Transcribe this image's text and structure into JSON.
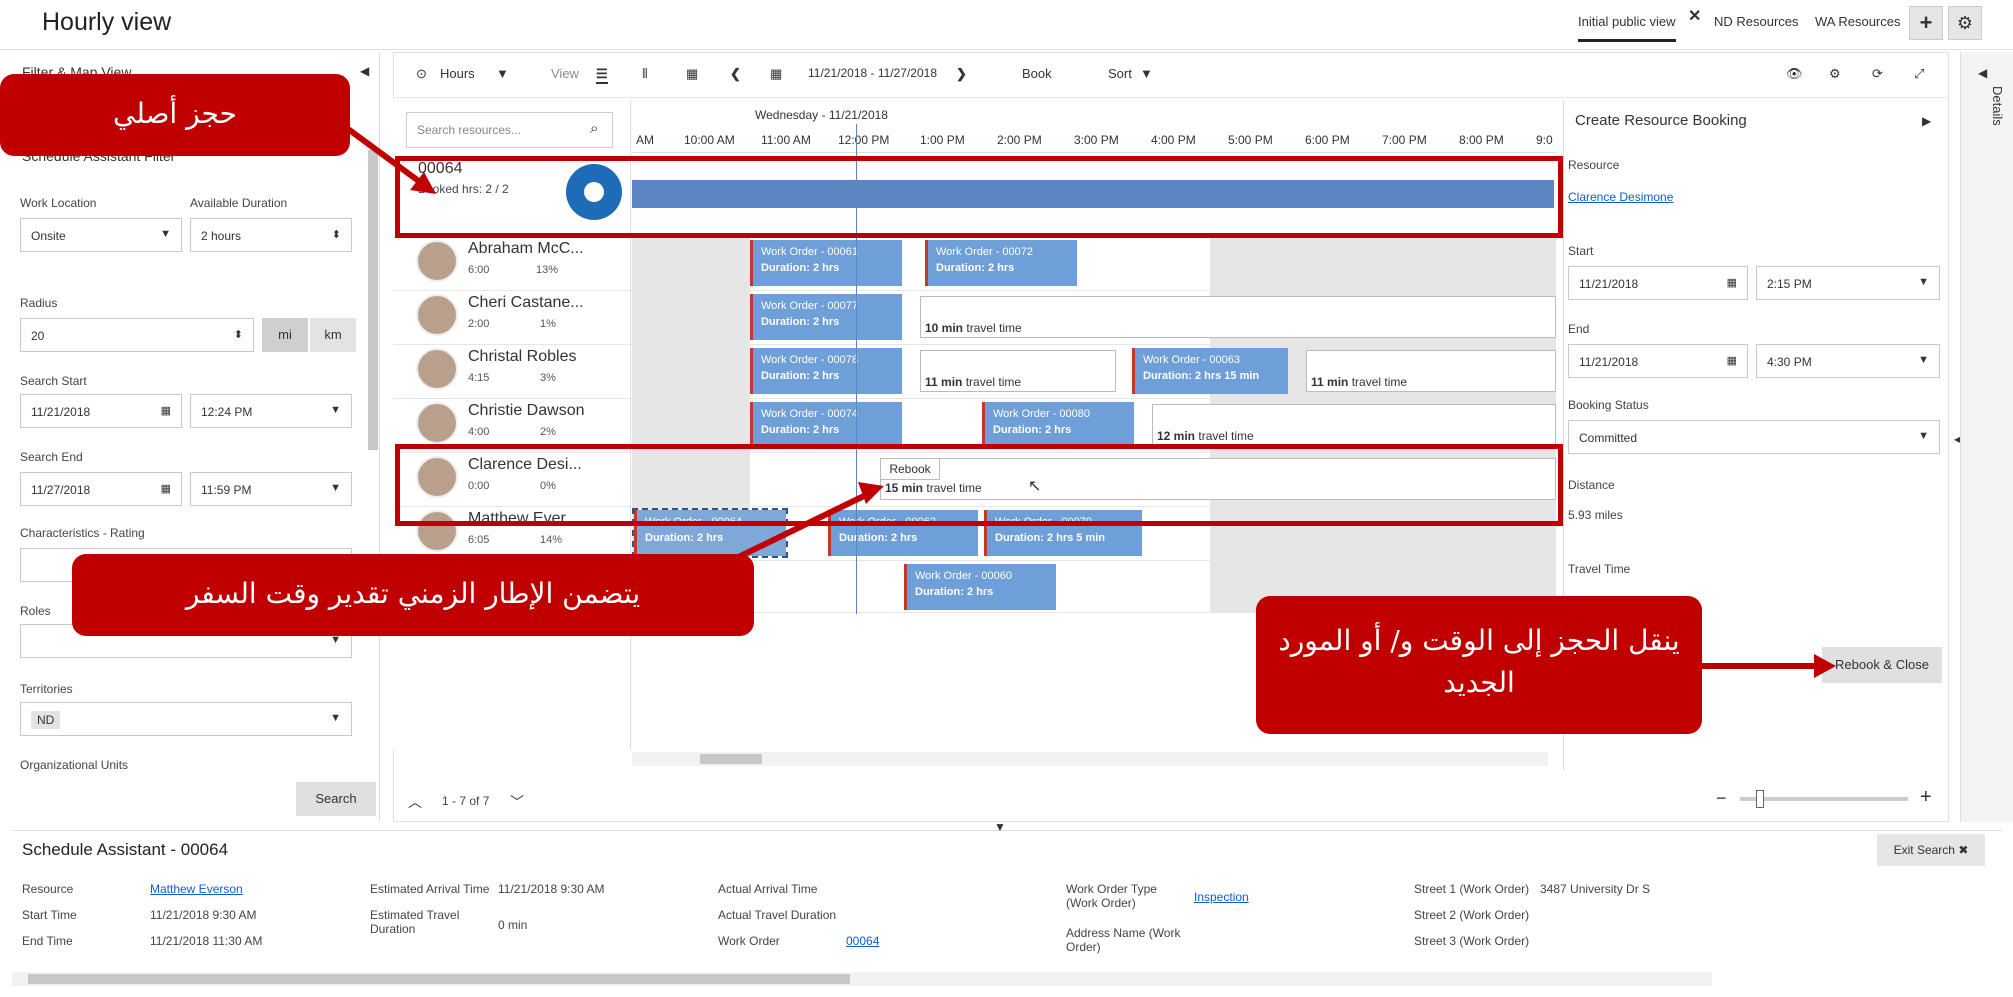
{
  "app": {
    "title": "Hourly view"
  },
  "top_tabs": [
    {
      "label": "Initial public view",
      "close": "✕"
    },
    {
      "label": "ND Resources"
    },
    {
      "label": "WA Resources"
    }
  ],
  "top_actions": {
    "add": "+",
    "settings": "⚙"
  },
  "left_panel": {
    "header": "Filter & Map View",
    "subheader": "Schedule Assistant Filter",
    "work_location": {
      "label": "Work Location",
      "value": "Onsite"
    },
    "available_duration": {
      "label": "Available Duration",
      "value": "2 hours"
    },
    "radius": {
      "label": "Radius",
      "value": "20",
      "unit_mi": "mi",
      "unit_km": "km"
    },
    "search_start": {
      "label": "Search Start",
      "date": "11/21/2018",
      "time": "12:24 PM"
    },
    "search_end": {
      "label": "Search End",
      "date": "11/27/2018",
      "time": "11:59 PM"
    },
    "characteristics": {
      "label": "Characteristics - Rating"
    },
    "roles": {
      "label": "Roles"
    },
    "territories": {
      "label": "Territories",
      "tag": "ND"
    },
    "org_units": {
      "label": "Organizational Units"
    },
    "search_button": "Search"
  },
  "toolbar": {
    "hours": "Hours",
    "view": "View",
    "date_range": "11/21/2018 - 11/27/2018",
    "book": "Book",
    "sort": "Sort"
  },
  "resource_search": {
    "placeholder": "Search resources..."
  },
  "timeline": {
    "date": "Wednesday - 11/21/2018",
    "hours": [
      "AM",
      "10:00 AM",
      "11:00 AM",
      "12:00 PM",
      "1:00 PM",
      "2:00 PM",
      "3:00 PM",
      "4:00 PM",
      "5:00 PM",
      "6:00 PM",
      "7:00 PM",
      "8:00 PM",
      "9:0"
    ]
  },
  "requirement": {
    "id": "00064",
    "booked": "Booked hrs: 2 / 2"
  },
  "resources": [
    {
      "name": "Abraham McC...",
      "hours": "6:00",
      "pct": "13%"
    },
    {
      "name": "Cheri Castane...",
      "hours": "2:00",
      "pct": "1%"
    },
    {
      "name": "Christal Robles",
      "hours": "4:15",
      "pct": "3%"
    },
    {
      "name": "Christie Dawson",
      "hours": "4:00",
      "pct": "2%"
    },
    {
      "name": "Clarence Desi...",
      "hours": "0:00",
      "pct": "0%"
    },
    {
      "name": "Matthew Ever...",
      "hours": "6:05",
      "pct": "14%"
    }
  ],
  "work_orders": {
    "wo61": {
      "title": "Work Order - 00061",
      "duration": "Duration: 2 hrs"
    },
    "wo72": {
      "title": "Work Order - 00072",
      "duration": "Duration: 2 hrs"
    },
    "wo77": {
      "title": "Work Order - 00077",
      "duration": "Duration: 2 hrs"
    },
    "wo78": {
      "title": "Work Order - 00078",
      "duration": "Duration: 2 hrs"
    },
    "wo63": {
      "title": "Work Order - 00063",
      "duration": "Duration: 2 hrs 15 min"
    },
    "wo74": {
      "title": "Work Order - 00074",
      "duration": "Duration: 2 hrs"
    },
    "wo80": {
      "title": "Work Order - 00080",
      "duration": "Duration: 2 hrs"
    },
    "wo64": {
      "title": "Work Order - 00064",
      "duration": "Duration: 2 hrs"
    },
    "wo62": {
      "title": "Work Order - 00062",
      "duration": "Duration: 2 hrs"
    },
    "wo70": {
      "title": "Work Order - 00070",
      "duration": "Duration: 2 hrs 5 min"
    },
    "wo60": {
      "title": "Work Order - 00060",
      "duration": "Duration: 2 hrs"
    }
  },
  "travel": {
    "t10": {
      "min": "10 min",
      "label": "travel time"
    },
    "t11a": {
      "min": "11 min",
      "label": "travel time"
    },
    "t11b": {
      "min": "11 min",
      "label": "travel time"
    },
    "t12": {
      "min": "12 min",
      "label": "travel time"
    },
    "t15": {
      "min": "15 min",
      "label": "travel time"
    }
  },
  "rebook_tip": "Rebook",
  "pager": "1 - 7 of 7",
  "booking_panel": {
    "title": "Create Resource Booking",
    "resource_label": "Resource",
    "resource_value": "Clarence Desimone",
    "start_label": "Start",
    "start_date": "11/21/2018",
    "start_time": "2:15 PM",
    "end_label": "End",
    "end_date": "11/21/2018",
    "end_time": "4:30 PM",
    "status_label": "Booking Status",
    "status_value": "Committed",
    "distance_label": "Distance",
    "distance_value": "5.93 miles",
    "travel_label": "Travel Time",
    "rebook_close": "Rebook & Close"
  },
  "details_tab": "Details",
  "bottom": {
    "title": "Schedule Assistant - 00064",
    "exit_search": "Exit Search",
    "resource_label": "Resource",
    "resource_value": "Matthew Everson",
    "start_label": "Start Time",
    "start_value": "11/21/2018 9:30 AM",
    "end_label": "End Time",
    "end_value": "11/21/2018 11:30 AM",
    "eat_label": "Estimated Arrival Time",
    "eat_value": "11/21/2018 9:30 AM",
    "etd_label": "Estimated Travel Duration",
    "etd_value": "0 min",
    "aat_label": "Actual Arrival Time",
    "atd_label": "Actual Travel Duration",
    "wo_label": "Work Order",
    "wo_value": "00064",
    "wot_label": "Work Order Type (Work Order)",
    "wot_value": "Inspection",
    "addr_label": "Address Name (Work Order)",
    "s1_label": "Street 1 (Work Order)",
    "s1_value": "3487 University Dr S",
    "s2_label": "Street 2 (Work Order)",
    "s3_label": "Street 3 (Work Order)"
  },
  "callouts": {
    "original": "حجز أصلي",
    "travel": "يتضمن الإطار الزمني تقدير وقت السفر",
    "moves": "ينقل الحجز إلى الوقت و/ أو المورد الجديد"
  },
  "colors": {
    "accent_red": "#c00000",
    "booking_blue": "#6f9fd8",
    "link": "#0b5ed7"
  }
}
